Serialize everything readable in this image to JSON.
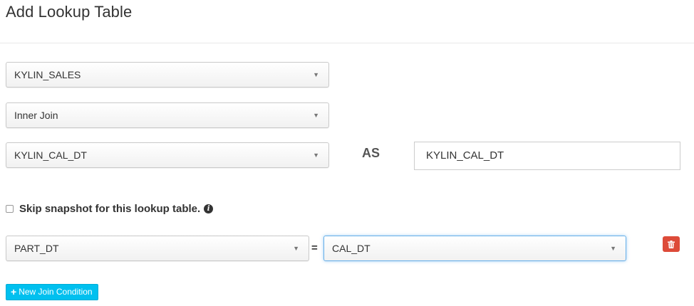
{
  "header": {
    "title": "Add Lookup Table"
  },
  "form": {
    "fact_table": {
      "selected": "KYLIN_SALES"
    },
    "join_type": {
      "selected": "Inner Join"
    },
    "lookup_table": {
      "selected": "KYLIN_CAL_DT"
    },
    "alias": {
      "label": "AS",
      "value": "KYLIN_CAL_DT"
    },
    "skip_snapshot": {
      "label": "Skip snapshot for this lookup table.",
      "checked": false,
      "info_icon": "info-circle-icon"
    },
    "join_condition": {
      "left_column": "PART_DT",
      "operator": "=",
      "right_column": "CAL_DT",
      "delete_icon": "trash-icon"
    },
    "new_join_button": {
      "label": "New Join Condition",
      "icon": "plus-icon"
    }
  },
  "colors": {
    "delete_button": "#dd4b39",
    "new_join_button": "#00c0ef",
    "focus_border": "#66afe9"
  }
}
